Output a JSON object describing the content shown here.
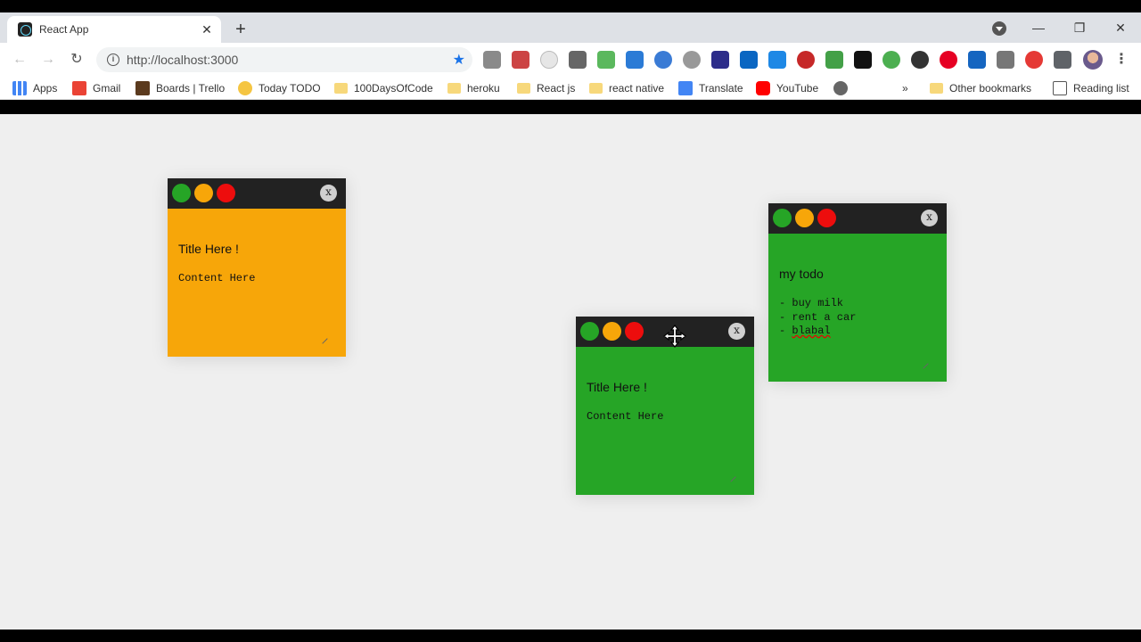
{
  "browser": {
    "tab_title": "React App",
    "tab_close": "✕",
    "new_tab": "+",
    "url": "http://localhost:3000",
    "bookmarks": {
      "apps": "Apps",
      "gmail": "Gmail",
      "trello": "Boards | Trello",
      "today": "Today TODO",
      "days100": "100DaysOfCode",
      "heroku": "heroku",
      "reactjs": "React js",
      "reactnative": "react native",
      "translate": "Translate",
      "youtube": "YouTube",
      "overflow": "»",
      "other": "Other bookmarks",
      "reading": "Reading list"
    },
    "window_controls": {
      "minimize": "—",
      "restore": "❐",
      "close": "✕"
    }
  },
  "notes": [
    {
      "title": "Title Here !",
      "content": "Content Here",
      "color": "#f7a609",
      "close_label": "x"
    },
    {
      "title": "Title Here !",
      "content": "Content Here",
      "color": "#26a526",
      "close_label": "x"
    },
    {
      "title": "my todo",
      "content_lines": [
        "- buy milk",
        "- rent a car"
      ],
      "content_prefix": "- ",
      "content_underlined": "blabal",
      "color": "#26a526",
      "close_label": "x"
    }
  ],
  "colors": {
    "traffic_green": "#26a526",
    "traffic_yellow": "#f7a609",
    "traffic_red": "#ed0d0d",
    "note_bar": "#222222",
    "page_bg": "#efefef"
  }
}
